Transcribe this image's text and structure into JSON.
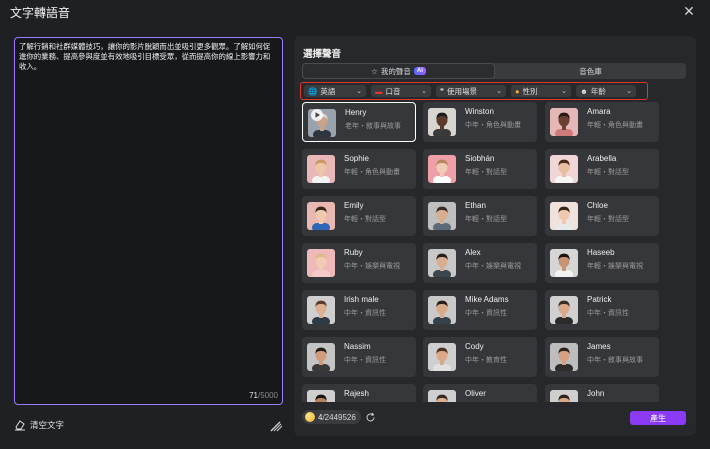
{
  "window": {
    "title": "文字轉語音"
  },
  "editor": {
    "text": "了解行銷和社群媒體技巧，讓你的影片脫穎而出並吸引更多觀眾。了解如何促進你的業務、提高參與度並有效地吸引目標受眾，從而提高你的線上影響力和收入。",
    "count_current": "71",
    "count_max": "/5000",
    "clear_label": "清空文字"
  },
  "panel": {
    "title": "選擇聲音",
    "tabs": [
      {
        "label": "我的聲音",
        "badge": "AI"
      },
      {
        "label": "音色庫"
      }
    ],
    "filters": [
      {
        "label": "英語",
        "icon": "globe-icon"
      },
      {
        "label": "口音",
        "icon": "flag-icon"
      },
      {
        "label": "使用場景",
        "icon": "quote-icon"
      },
      {
        "label": "性別",
        "icon": "person-icon"
      },
      {
        "label": "年齡",
        "icon": "age-icon"
      }
    ],
    "voices": [
      {
        "name": "Henry",
        "desc": "老年・敘事與故事",
        "skin": "#c9a48a",
        "hair": "#d8d8d8",
        "bg": "#9aa3ad",
        "shirt": "#2e3440"
      },
      {
        "name": "Winston",
        "desc": "中年・角色與動畫",
        "skin": "#5b3a29",
        "hair": "#1b1b1b",
        "bg": "#d8d4cf",
        "shirt": "#3a3a3a"
      },
      {
        "name": "Amara",
        "desc": "年輕・角色與動畫",
        "skin": "#6b4030",
        "hair": "#2a1a12",
        "bg": "#e6b7b7",
        "shirt": "#cf7a7a"
      },
      {
        "name": "Sophie",
        "desc": "年輕・角色與動畫",
        "skin": "#edc8a8",
        "hair": "#c89a63",
        "bg": "#e9b7b7",
        "shirt": "#f2f2f2"
      },
      {
        "name": "Siobhán",
        "desc": "年輕・對話型",
        "skin": "#efcdb4",
        "hair": "#b8865b",
        "bg": "#ef9fa7",
        "shirt": "#ffffff"
      },
      {
        "name": "Arabella",
        "desc": "年輕・對話型",
        "skin": "#e9c09f",
        "hair": "#4a2d1e",
        "bg": "#f0d6d6",
        "shirt": "#f5f5f5"
      },
      {
        "name": "Emily",
        "desc": "年輕・對話型",
        "skin": "#f1c9ac",
        "hair": "#3b2619",
        "bg": "#e9b8b0",
        "shirt": "#2f66b8"
      },
      {
        "name": "Ethan",
        "desc": "年輕・對話型",
        "skin": "#d9ad8f",
        "hair": "#3a2a20",
        "bg": "#bfbfbf",
        "shirt": "#5c6b7a"
      },
      {
        "name": "Chloe",
        "desc": "年輕・對話型",
        "skin": "#f0c8b0",
        "hair": "#3b2418",
        "bg": "#efe2dd",
        "shirt": "#e8e8e8"
      },
      {
        "name": "Ruby",
        "desc": "中年・娛樂與電視",
        "skin": "#f0ccb4",
        "hair": "#e0b88a",
        "bg": "#f0b9b9",
        "shirt": "#f3c9c9"
      },
      {
        "name": "Alex",
        "desc": "中年・娛樂與電視",
        "skin": "#d8ad90",
        "hair": "#2a1f18",
        "bg": "#c8c8c8",
        "shirt": "#3a4650"
      },
      {
        "name": "Haseeb",
        "desc": "年輕・娛樂與電視",
        "skin": "#c79574",
        "hair": "#1c1410",
        "bg": "#d6d6d6",
        "shirt": "#f2f2f2"
      },
      {
        "name": "Irish male",
        "desc": "中年・資訊性",
        "skin": "#deb092",
        "hair": "#5a3e2b",
        "bg": "#cfcfcf",
        "shirt": "#2f3a45"
      },
      {
        "name": "Mike Adams",
        "desc": "中年・資訊性",
        "skin": "#d9a98a",
        "hair": "#2a1f18",
        "bg": "#c9c9c9",
        "shirt": "#35414d"
      },
      {
        "name": "Patrick",
        "desc": "中年・資訊性",
        "skin": "#d9a98a",
        "hair": "#3a2a20",
        "bg": "#d0d0d0",
        "shirt": "#2b2b2b"
      },
      {
        "name": "Nassim",
        "desc": "中年・資訊性",
        "skin": "#cf9d7e",
        "hair": "#241a14",
        "bg": "#c4c4c4",
        "shirt": "#3a3a3a"
      },
      {
        "name": "Cody",
        "desc": "中年・教育性",
        "skin": "#dba98a",
        "hair": "#4a3322",
        "bg": "#cfcfcf",
        "shirt": "#e0e0e0"
      },
      {
        "name": "James",
        "desc": "中年・敘事與故事",
        "skin": "#d4a283",
        "hair": "#2e221a",
        "bg": "#bdbdbd",
        "shirt": "#2d2d2d"
      },
      {
        "name": "Rajesh",
        "desc": "",
        "skin": "#b7845f",
        "hair": "#1a1410",
        "bg": "#cfcfcf",
        "shirt": "#3a3a3a"
      },
      {
        "name": "Oliver",
        "desc": "",
        "skin": "#dcae90",
        "hair": "#3a2a20",
        "bg": "#cfcfcf",
        "shirt": "#3a3a3a"
      },
      {
        "name": "John",
        "desc": "",
        "skin": "#d8a888",
        "hair": "#2e221a",
        "bg": "#cfcfcf",
        "shirt": "#3a3a3a"
      }
    ],
    "selected_index": 0
  },
  "credits": {
    "current": "4",
    "total": "/2449526"
  },
  "generate_label": "產生",
  "colors": {
    "accent": "#8b3bf6",
    "highlight": "#e0362f",
    "editor_border": "#9b7cff"
  }
}
